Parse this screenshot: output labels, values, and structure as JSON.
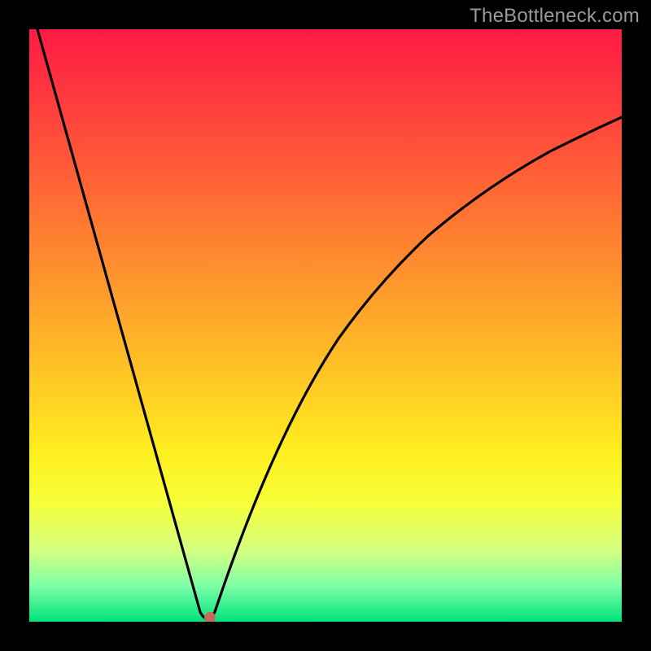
{
  "brand": {
    "label": "TheBottleneck.com"
  },
  "chart_data": {
    "type": "line",
    "title": "",
    "xlabel": "",
    "ylabel": "",
    "xlim": [
      0,
      1
    ],
    "ylim": [
      0,
      1
    ],
    "curve": {
      "left_branch": {
        "x": [
          0.0,
          0.3
        ],
        "y": [
          1.0,
          0.0
        ],
        "description": "straight descent from top-left to valley"
      },
      "right_branch": {
        "x": [
          0.3,
          0.4,
          0.5,
          0.6,
          0.7,
          0.8,
          0.9,
          1.0
        ],
        "y": [
          0.0,
          0.29,
          0.48,
          0.61,
          0.7,
          0.77,
          0.82,
          0.86
        ],
        "description": "concave rise from valley toward upper-right"
      }
    },
    "valley": {
      "x": 0.3,
      "y": 0.0
    },
    "marker": {
      "x": 0.305,
      "y": 0.0,
      "color": "#c86a5a"
    },
    "background_gradient": [
      "#ff1a45",
      "#ff3b3e",
      "#ff5e36",
      "#ff8230",
      "#ffa62a",
      "#ffca24",
      "#fff01f",
      "#f6ff3a",
      "#d5ff80",
      "#7dffa8",
      "#00e37a"
    ]
  }
}
